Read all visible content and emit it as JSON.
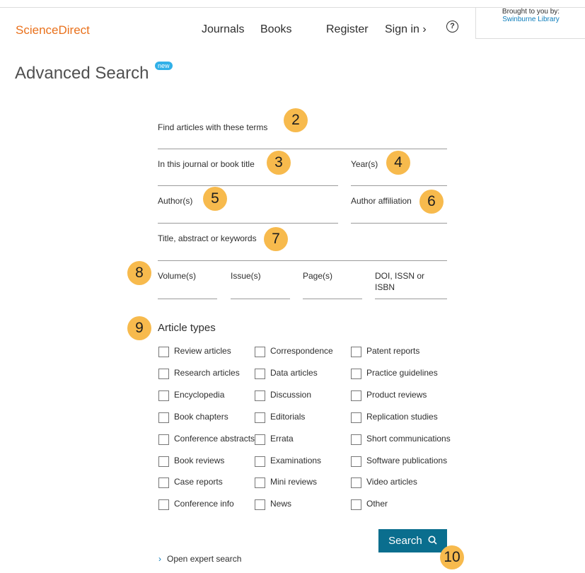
{
  "header": {
    "logo": "ScienceDirect",
    "nav": {
      "journals": "Journals",
      "books": "Books",
      "register": "Register",
      "sign_in": "Sign in ›"
    },
    "help_glyph": "?",
    "brought_by": "Brought to you by:",
    "institution": "Swinburne Library"
  },
  "page": {
    "title": "Advanced Search",
    "new_badge": "new"
  },
  "form": {
    "terms_label": "Find articles with these terms",
    "journal_label": "In this journal or book title",
    "year_label": "Year(s)",
    "author_label": "Author(s)",
    "affiliation_label": "Author affiliation",
    "title_label": "Title, abstract or keywords",
    "volume_label": "Volume(s)",
    "issue_label": "Issue(s)",
    "page_label": "Page(s)",
    "doi_label_1": "DOI, ISSN or",
    "doi_label_2": "ISBN"
  },
  "annotations": [
    "2",
    "3",
    "4",
    "5",
    "6",
    "7",
    "8",
    "9",
    "10"
  ],
  "article_types": {
    "title": "Article types",
    "columns": [
      [
        "Review articles",
        "Research articles",
        "Encyclopedia",
        "Book chapters",
        "Conference abstracts",
        "Book reviews",
        "Case reports",
        "Conference info"
      ],
      [
        "Correspondence",
        "Data articles",
        "Discussion",
        "Editorials",
        "Errata",
        "Examinations",
        "Mini reviews",
        "News"
      ],
      [
        "Patent reports",
        "Practice guidelines",
        "Product reviews",
        "Replication studies",
        "Short communications",
        "Software publications",
        "Video articles",
        "Other"
      ]
    ]
  },
  "search_button": "Search",
  "expert_search": "Open expert search",
  "colors": {
    "brand": "#e9711c",
    "button": "#0a6e8e",
    "badge": "#f7ba4d",
    "new": "#31b0e8",
    "link": "#0c7dbb"
  }
}
